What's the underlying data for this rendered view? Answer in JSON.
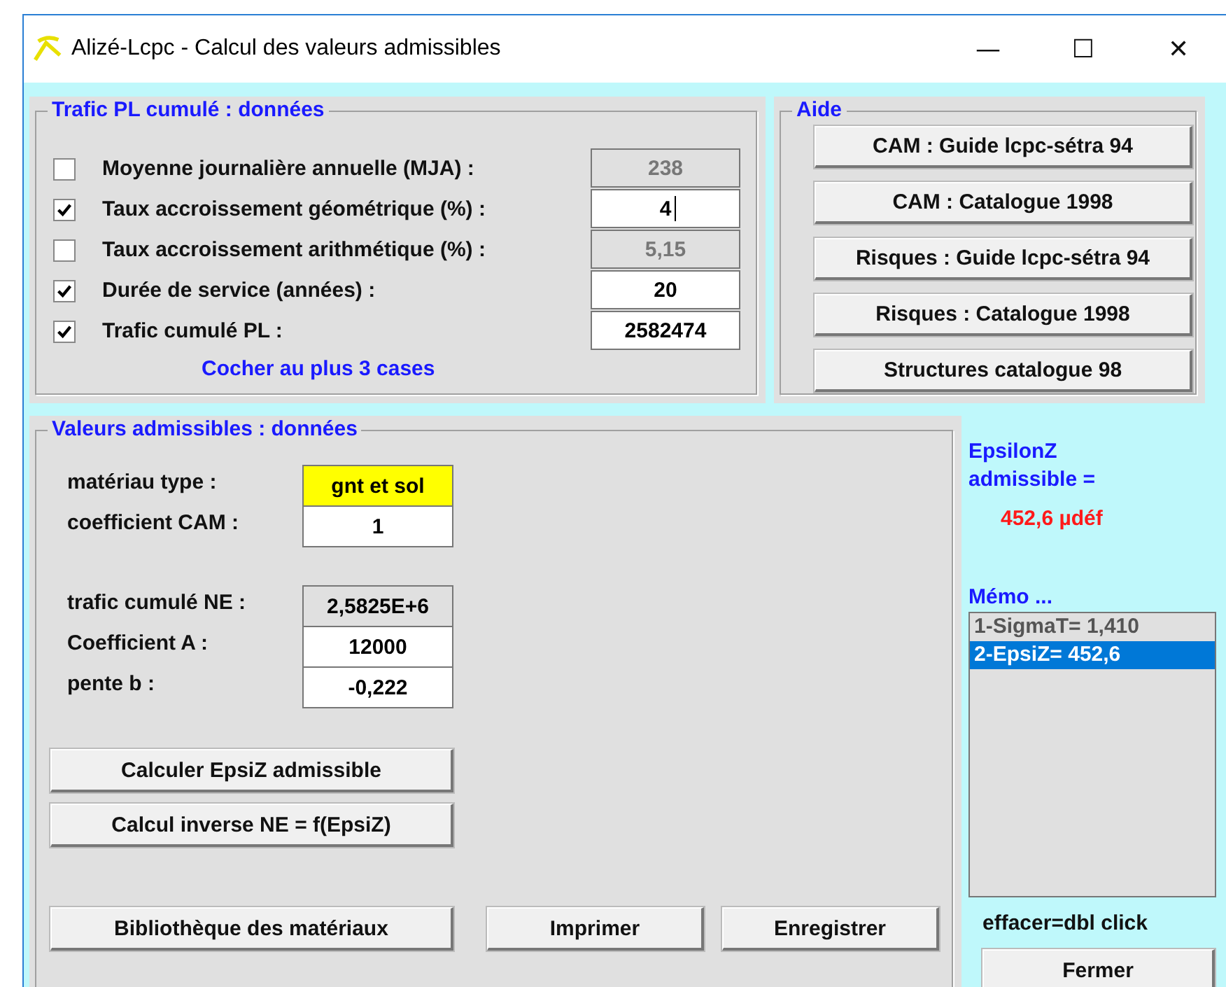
{
  "window": {
    "title": "Alizé-Lcpc - Calcul des valeurs admissibles",
    "controls": [
      "—",
      "☐",
      "✕"
    ]
  },
  "trafic": {
    "legend": "Trafic PL cumulé : données",
    "hint": "Cocher au plus 3 cases",
    "rows": [
      {
        "label": "Moyenne journalière annuelle (MJA) :",
        "value": "238",
        "checked": false,
        "disabled": true,
        "focused": false
      },
      {
        "label": "Taux accroissement géométrique (%) :",
        "value": "4",
        "checked": true,
        "disabled": false,
        "focused": true
      },
      {
        "label": "Taux accroissement arithmétique (%) :",
        "value": "5,15",
        "checked": false,
        "disabled": true,
        "focused": false
      },
      {
        "label": "Durée de service  (années) :",
        "value": "20",
        "checked": true,
        "disabled": false,
        "focused": false
      },
      {
        "label": "Trafic cumulé PL :",
        "value": "2582474",
        "checked": true,
        "disabled": false,
        "focused": false
      }
    ]
  },
  "aide": {
    "legend": "Aide",
    "buttons": [
      "CAM : Guide lcpc-sétra 94",
      "CAM : Catalogue 1998",
      "Risques : Guide lcpc-sétra 94",
      "Risques : Catalogue 1998",
      "Structures catalogue 98"
    ]
  },
  "valeurs": {
    "legend": "Valeurs admissibles : données",
    "groups": [
      [
        {
          "label": "matériau type :",
          "value": "gnt et sol",
          "highlighted": true,
          "disabled": false
        },
        {
          "label": "coefficient CAM :",
          "value": "1",
          "highlighted": false,
          "disabled": false
        }
      ],
      [
        {
          "label": "trafic cumulé NE :",
          "value": "2,5825E+6",
          "highlighted": false,
          "disabled": true
        },
        {
          "label": "Coefficient A :",
          "value": "12000",
          "highlighted": false,
          "disabled": false
        },
        {
          "label": "pente b :",
          "value": "-0,222",
          "highlighted": false,
          "disabled": false
        }
      ]
    ],
    "calc_buttons": [
      "Calculer EpsiZ admissible",
      "Calcul inverse NE = f(EpsiZ)"
    ],
    "bottom_buttons": [
      "Bibliothèque des matériaux",
      "Imprimer",
      "Enregistrer"
    ]
  },
  "result": {
    "label": "EpsilonZ admissible =",
    "value": "452,6 µdéf"
  },
  "memo": {
    "label": "Mémo ...",
    "items": [
      {
        "text": "1-SigmaT= 1,410",
        "selected": false
      },
      {
        "text": "2-EpsiZ= 452,6",
        "selected": true
      }
    ],
    "hint": "effacer=dbl click"
  },
  "close_button": "Fermer"
}
